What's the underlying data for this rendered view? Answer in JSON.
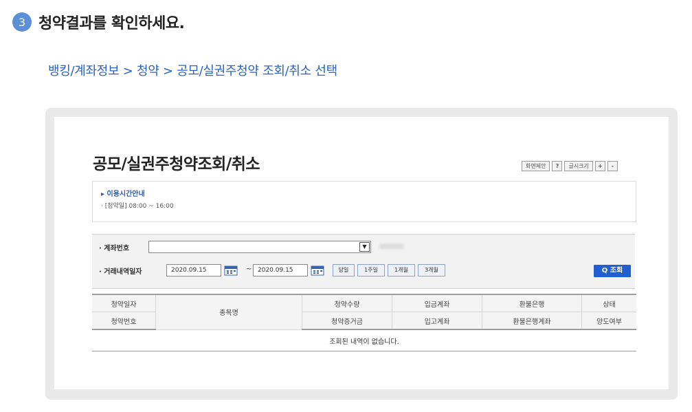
{
  "step": {
    "number": "3",
    "title": "청약결과를 확인하세요."
  },
  "breadcrumb": "뱅킹/계좌정보 > 청약 > 공모/실권주청약 조회/취소 선택",
  "screen": {
    "title": "공모/실권주청약조회/취소",
    "tools": {
      "suggest": "화면제안",
      "help": "?",
      "font_size": "글시크기",
      "plus": "+",
      "minus": "-"
    },
    "notice": {
      "title": "▸ 이용시간안내",
      "text": "· [청약일] 08:00 ~ 16:00"
    },
    "search": {
      "account_label": "· 계좌번호",
      "date_label": "· 거래내역일자",
      "date_from": "2020.09.15",
      "date_to": "2020.09.15",
      "tilde": "~",
      "periods": [
        "당일",
        "1주일",
        "1개월",
        "3개월"
      ],
      "search_button": "Q 조회"
    },
    "table": {
      "headers_row1": [
        "청약일자",
        "종목명",
        "청약수량",
        "입금계좌",
        "환불은행",
        "상태"
      ],
      "headers_row2": [
        "청약번호",
        "청약증거금",
        "입고계좌",
        "환불은행계좌",
        "양도여부"
      ],
      "empty_message": "조회된 내역이 없습니다."
    }
  },
  "colors": {
    "accent": "#2b63c4",
    "step_badge": "#5b8fd8",
    "search_button": "#1f5fd1"
  }
}
